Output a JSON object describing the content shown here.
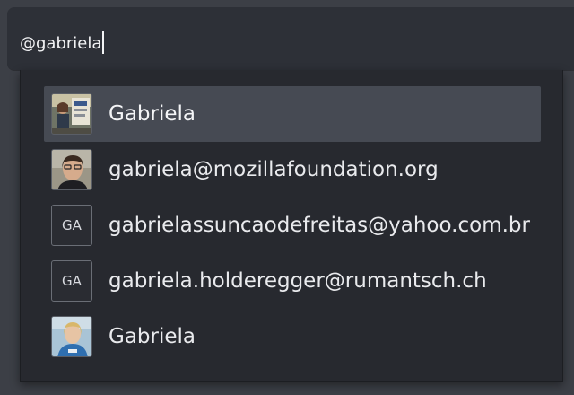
{
  "composer": {
    "text": "@gabriela"
  },
  "suggestions": [
    {
      "label": "Gabriela",
      "avatar": "photo",
      "initials": "",
      "selected": true
    },
    {
      "label": "gabriela@mozillafoundation.org",
      "avatar": "photo",
      "initials": "",
      "selected": false
    },
    {
      "label": "gabrielassuncaodefreitas@yahoo.com.br",
      "avatar": "initials",
      "initials": "GA",
      "selected": false
    },
    {
      "label": "gabriela.holderegger@rumantsch.ch",
      "avatar": "initials",
      "initials": "GA",
      "selected": false
    },
    {
      "label": "Gabriela",
      "avatar": "photo",
      "initials": "",
      "selected": false
    }
  ],
  "colors": {
    "background": "#3c3f46",
    "composer": "#2d3037",
    "popup": "#27292f",
    "selected_row": "#464a53",
    "text": "#e9eaed"
  }
}
